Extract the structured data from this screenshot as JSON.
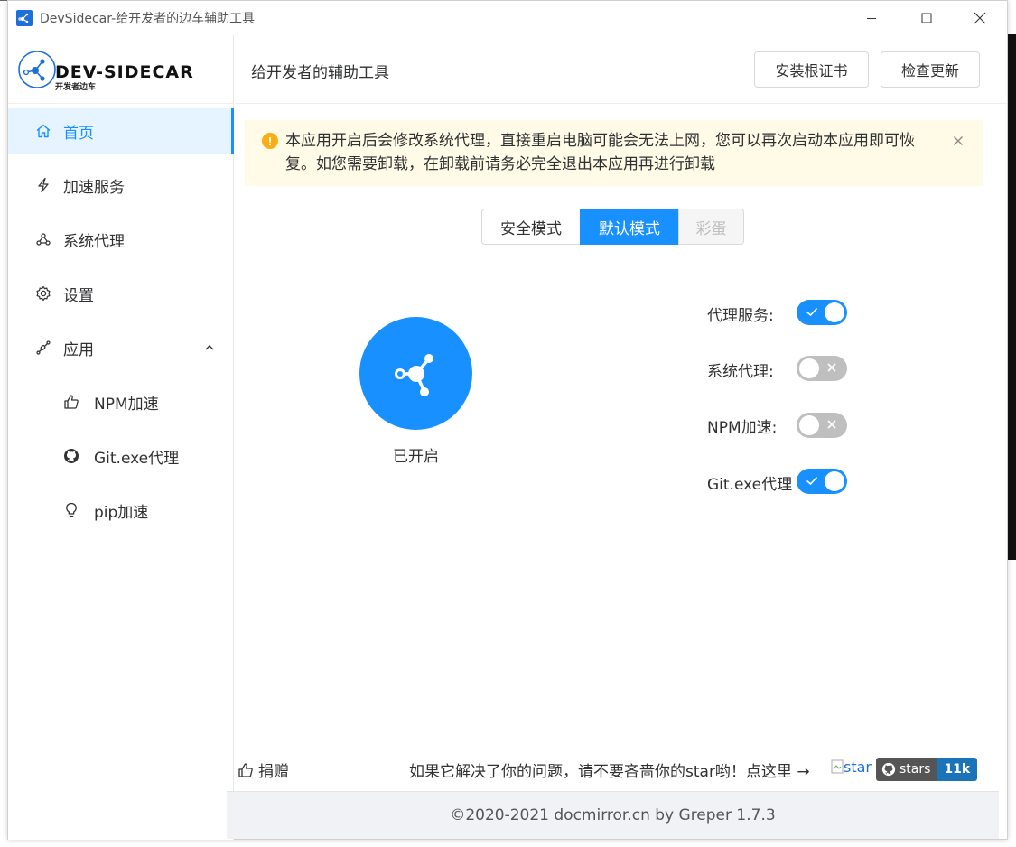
{
  "window": {
    "title": "DevSidecar-给开发者的边车辅助工具"
  },
  "logo": {
    "name": "DEV-SIDECAR",
    "subtitle": "开发者边车"
  },
  "sidebar": {
    "items": [
      {
        "label": "首页",
        "icon": "home-icon",
        "active": true
      },
      {
        "label": "加速服务",
        "icon": "thunderbolt-icon"
      },
      {
        "label": "系统代理",
        "icon": "network-icon"
      },
      {
        "label": "设置",
        "icon": "gear-icon"
      },
      {
        "label": "应用",
        "icon": "api-icon",
        "expanded": true
      },
      {
        "label": "NPM加速",
        "icon": "thumbs-up-icon"
      },
      {
        "label": "Git.exe代理",
        "icon": "github-icon"
      },
      {
        "label": "pip加速",
        "icon": "bulb-icon"
      }
    ]
  },
  "header": {
    "title": "给开发者的辅助工具",
    "install_cert": "安装根证书",
    "check_update": "检查更新"
  },
  "alert": {
    "text": "本应用开启后会修改系统代理，直接重启电脑可能会无法上网，您可以再次启动本应用即可恢复。如您需要卸载，在卸载前请务必完全退出本应用再进行卸载"
  },
  "modes": {
    "options": [
      "安全模式",
      "默认模式",
      "彩蛋"
    ],
    "selected": "默认模式"
  },
  "main_switch": {
    "status": "已开启",
    "on": true
  },
  "toggles": [
    {
      "label": "代理服务:",
      "on": true
    },
    {
      "label": "系统代理:",
      "on": false
    },
    {
      "label": "NPM加速:",
      "on": false
    },
    {
      "label": "Git.exe代理",
      "on": true
    }
  ],
  "footer": {
    "donate": "捐赠",
    "star_prompt": "如果它解决了你的问题，请不要吝啬你的star哟！点这里 →",
    "broken_img_alt": "star",
    "badge_label": "stars",
    "badge_count": "11k",
    "copyright": "©2020-2021 docmirror.cn by Greper  1.7.3"
  },
  "colors": {
    "primary": "#1890ff",
    "alert_bg": "#fffbe6",
    "warning": "#faad14"
  }
}
